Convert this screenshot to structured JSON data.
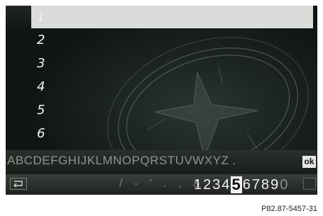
{
  "list": {
    "items": [
      {
        "label": "1",
        "selected": true
      },
      {
        "label": "2",
        "selected": false
      },
      {
        "label": "3",
        "selected": false
      },
      {
        "label": "4",
        "selected": false
      },
      {
        "label": "5",
        "selected": false
      },
      {
        "label": "6",
        "selected": false
      }
    ]
  },
  "keyboard": {
    "letters": "ABCDEFGHIJKLMNOPQRSTUVWXYZ .",
    "ok_label": "ok",
    "punctuation": "/ - ' . , &",
    "digits": [
      "1",
      "2",
      "3",
      "4",
      "5",
      "6",
      "7",
      "8",
      "9",
      "0"
    ],
    "selected_digit": "5",
    "back_icon": "back-icon"
  },
  "caption": "P82.87-5457-31",
  "colors": {
    "screen_bg": "#0f1512",
    "selected_row": "#d9dcd8",
    "text": "#f2f2f2"
  }
}
